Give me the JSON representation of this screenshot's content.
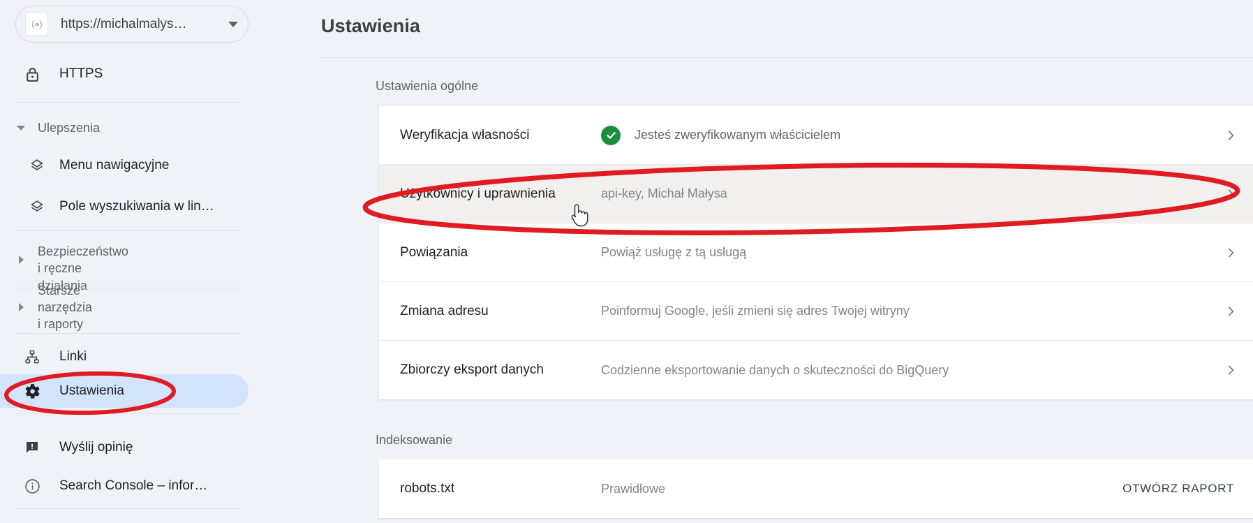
{
  "accent": {
    "selected_nav_bg": "#d2e3fc",
    "annotation_red": "#e01b22",
    "verified_green": "#1e8e3e",
    "page_bg": "#eff3f8",
    "card_bg": "#ffffff",
    "hover_row_bg": "#f1f0ee"
  },
  "sidebar": {
    "property_selector": {
      "favicon_icon": "site-favicon-icon",
      "favicon_glyph": "{≈}",
      "value": "https://michalmalys…",
      "caret_icon": "chevron-down-icon"
    },
    "items": [
      {
        "label": "HTTPS",
        "icon": "lock-icon",
        "type": "item",
        "state": "normal"
      },
      {
        "label": "Ulepszenia",
        "icon": "triangle-down-icon",
        "type": "group-expanded",
        "state": "muted"
      },
      {
        "label": "Menu nawigacyjne",
        "icon": "layers-icon",
        "type": "sub-item",
        "state": "normal"
      },
      {
        "label": "Pole wyszukiwania w lin…",
        "icon": "layers-icon",
        "type": "sub-item",
        "state": "normal"
      },
      {
        "label": "Bezpieczeństwo i ręczne\ndziałania",
        "icon": "triangle-right-icon",
        "type": "group-collapsed",
        "state": "muted"
      },
      {
        "label": "Starsze narzędzia i raporty",
        "icon": "triangle-right-icon",
        "type": "group-collapsed",
        "state": "muted"
      },
      {
        "label": "Linki",
        "icon": "links-hierarchy-icon",
        "type": "item",
        "state": "normal"
      },
      {
        "label": "Ustawienia",
        "icon": "gear-icon",
        "type": "item",
        "state": "selected"
      },
      {
        "label": "Wyślij opinię",
        "icon": "feedback-icon",
        "type": "item",
        "state": "normal"
      },
      {
        "label": "Search Console – infor…",
        "icon": "info-circle-icon",
        "type": "item",
        "state": "normal"
      }
    ]
  },
  "main": {
    "page_title": "Ustawienia",
    "sections": [
      {
        "label": "Ustawienia ogólne",
        "rows": [
          {
            "name": "Weryfikacja własności",
            "status": "Jesteś zweryfikowanym właścicielem",
            "status_icon": "verified-check-icon",
            "action": "",
            "chevron_icon": "chevron-right-icon",
            "hovered": false
          },
          {
            "name": "Użytkownicy i uprawnienia",
            "status": "api-key, Michał Małysa",
            "status_icon": "",
            "action": "",
            "chevron_icon": "chevron-right-icon",
            "hovered": true
          },
          {
            "name": "Powiązania",
            "status": "Powiąż usługę z tą usługą",
            "status_icon": "",
            "action": "",
            "chevron_icon": "chevron-right-icon",
            "hovered": false
          },
          {
            "name": "Zmiana adresu",
            "status": "Poinformuj Google, jeśli zmieni się adres Twojej witryny",
            "status_icon": "",
            "action": "",
            "chevron_icon": "chevron-right-icon",
            "hovered": false
          },
          {
            "name": "Zbiorczy eksport danych",
            "status": "Codzienne eksportowanie danych o skuteczności do BigQuery",
            "status_icon": "",
            "action": "",
            "chevron_icon": "chevron-right-icon",
            "hovered": false
          }
        ]
      },
      {
        "label": "Indeksowanie",
        "rows": [
          {
            "name": "robots.txt",
            "status": "Prawidłowe",
            "status_icon": "",
            "action": "OTWÓRZ RAPORT",
            "chevron_icon": "",
            "hovered": false
          }
        ]
      }
    ]
  },
  "annotations": {
    "ellipse_sidebar_target": "Ustawienia",
    "ellipse_row_target": "Użytkownicy i uprawnienia",
    "cursor_icon": "pointing-hand-cursor-icon"
  }
}
